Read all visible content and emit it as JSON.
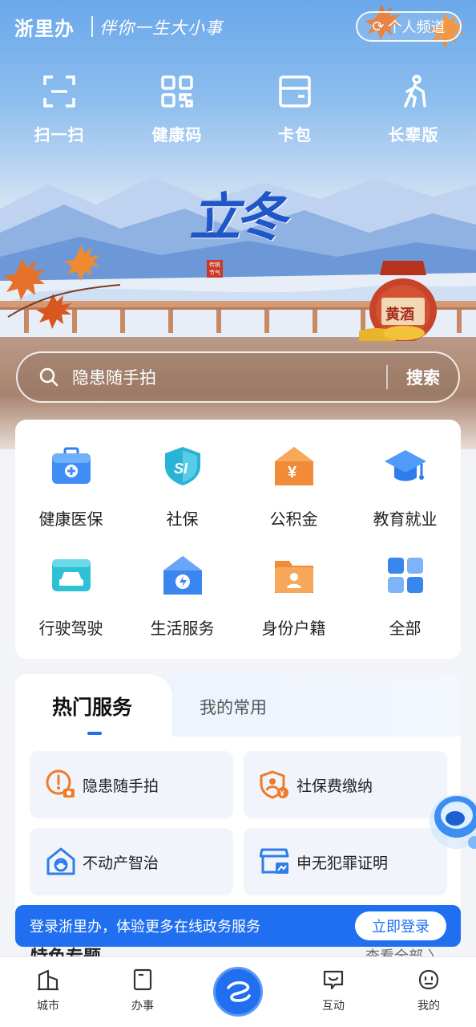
{
  "header": {
    "logo": "浙里办",
    "slogan": "伴你一生大小事",
    "channel_button": "个人频道",
    "channel_icon": "refresh-icon"
  },
  "quick_actions": [
    {
      "label": "扫一扫",
      "icon": "scan-icon"
    },
    {
      "label": "健康码",
      "icon": "qr-code-icon"
    },
    {
      "label": "卡包",
      "icon": "card-wallet-icon"
    },
    {
      "label": "长辈版",
      "icon": "elder-icon"
    }
  ],
  "banner": {
    "title": "立冬",
    "seal": "传统节气",
    "jar_label": "黄酒"
  },
  "search": {
    "placeholder": "隐患随手拍",
    "button": "搜索"
  },
  "services": [
    {
      "label": "健康医保",
      "icon": "medical-kit-icon"
    },
    {
      "label": "社保",
      "icon": "social-security-icon"
    },
    {
      "label": "公积金",
      "icon": "housing-fund-icon"
    },
    {
      "label": "教育就业",
      "icon": "graduation-cap-icon"
    },
    {
      "label": "行驶驾驶",
      "icon": "car-icon"
    },
    {
      "label": "生活服务",
      "icon": "home-service-icon"
    },
    {
      "label": "身份户籍",
      "icon": "id-folder-icon"
    },
    {
      "label": "全部",
      "icon": "grid-all-icon"
    }
  ],
  "hot_services": {
    "tabs": [
      "热门服务",
      "我的常用"
    ],
    "active_tab": "热门服务",
    "items": [
      {
        "label": "隐患随手拍",
        "icon": "hazard-camera-icon"
      },
      {
        "label": "社保费缴纳",
        "icon": "social-fee-icon"
      },
      {
        "label": "不动产智治",
        "icon": "real-estate-icon"
      },
      {
        "label": "申无犯罪证明",
        "icon": "certificate-icon"
      }
    ]
  },
  "next_section": {
    "title": "特色专题",
    "more": "查看全部 〉"
  },
  "login_banner": {
    "text": "登录浙里办，体验更多在线政务服务",
    "button": "立即登录"
  },
  "bottom_nav": [
    {
      "label": "城市",
      "icon": "city-icon"
    },
    {
      "label": "办事",
      "icon": "document-icon"
    },
    {
      "label": "",
      "icon": "zheliban-logo-icon"
    },
    {
      "label": "互动",
      "icon": "chat-icon"
    },
    {
      "label": "我的",
      "icon": "user-face-icon"
    }
  ],
  "colors": {
    "primary": "#1f6ff0",
    "hero_sky": "#6aa8ea",
    "title_blue": "#1f56c8",
    "jar_red": "#a62b1b"
  }
}
